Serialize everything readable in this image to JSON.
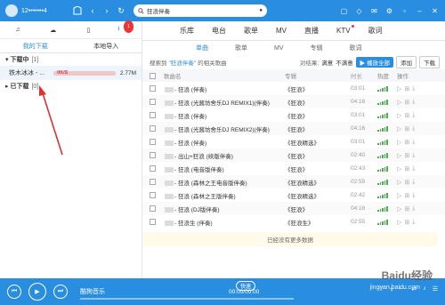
{
  "topbar": {
    "user": "12•••••••4",
    "search_value": "狂浪伴奏"
  },
  "sidebar": {
    "tabs": [
      "我的下载",
      "本地导入"
    ],
    "download_badge": "1",
    "downloading_label": "下载中",
    "downloading_count": "[1]",
    "downloaded_label": "已下载",
    "downloaded_count": "[0]",
    "item": {
      "title": "铁木冰冰 - ...",
      "speed": "0K/S",
      "size": "2.77M"
    }
  },
  "main": {
    "tabs": [
      "乐库",
      "电台",
      "歌单",
      "MV",
      "直播",
      "KTV",
      "歌词"
    ],
    "subtabs": [
      "单曲",
      "歌单",
      "MV",
      "专辑",
      "歌词"
    ],
    "info_prefix": "搜索到",
    "info_keyword": "\"狂浪伴奏\"",
    "info_suffix": "的相关歌曲",
    "quality_label": "对结果:",
    "quality_a": "满意",
    "quality_b": "不满意",
    "play_all": "▶ 播放全部",
    "add": "添加",
    "download": "下载",
    "headers": {
      "title": "歌曲名",
      "album": "专辑",
      "duration": "时长",
      "popularity": "热度",
      "ops": "操作"
    },
    "rows": [
      {
        "title": "- 狂浪 (伴奏)",
        "album": "《狂浪》",
        "duration": "03:01"
      },
      {
        "title": "- 狂浪 (光酱坊舍乐DJ REMIX1)(伴奏)",
        "album": "《狂浪》",
        "duration": "04:16"
      },
      {
        "title": "- 狂浪 (伴奏)",
        "album": "《狂浪》",
        "duration": "03:01"
      },
      {
        "title": "- 狂浪 (光酱坊舍乐DJ REMIX2)(伴奏)",
        "album": "《狂浪》",
        "duration": "04:16"
      },
      {
        "title": "- 狂浪 (伴奏)",
        "album": "《狂浪精选》",
        "duration": "03:01"
      },
      {
        "title": "- 出山+狂浪 (续版伴奏)",
        "album": "《狂浪》",
        "duration": "02:40"
      },
      {
        "title": "- 狂浪 (电音版伴奏)",
        "album": "《狂浪》",
        "duration": "02:43"
      },
      {
        "title": "- 狂浪 (森林之王电音版伴奏)",
        "album": "《狂浪精选》",
        "duration": "02:55"
      },
      {
        "title": "- 狂浪 (森林之王版伴奏)",
        "album": "《狂浪精选》",
        "duration": "02:42"
      },
      {
        "title": "- 狂浪 (DJ版伴奏)",
        "album": "《狂浪》",
        "duration": "04:16"
      },
      {
        "title": "- 狂浪生 (伴奏)",
        "album": "《狂浪生》",
        "duration": "02:55"
      }
    ],
    "no_more": "已经没有更多数据"
  },
  "player": {
    "title": "酷狗音乐",
    "chip": "快速",
    "time": "00:00/00:00"
  },
  "watermark": {
    "text": "Baidu经验",
    "url": "jingyan.baidu.com"
  },
  "colors": {
    "accent": "#2a8ee0",
    "popularity": "#4caf50",
    "annotation": "#e03030"
  }
}
